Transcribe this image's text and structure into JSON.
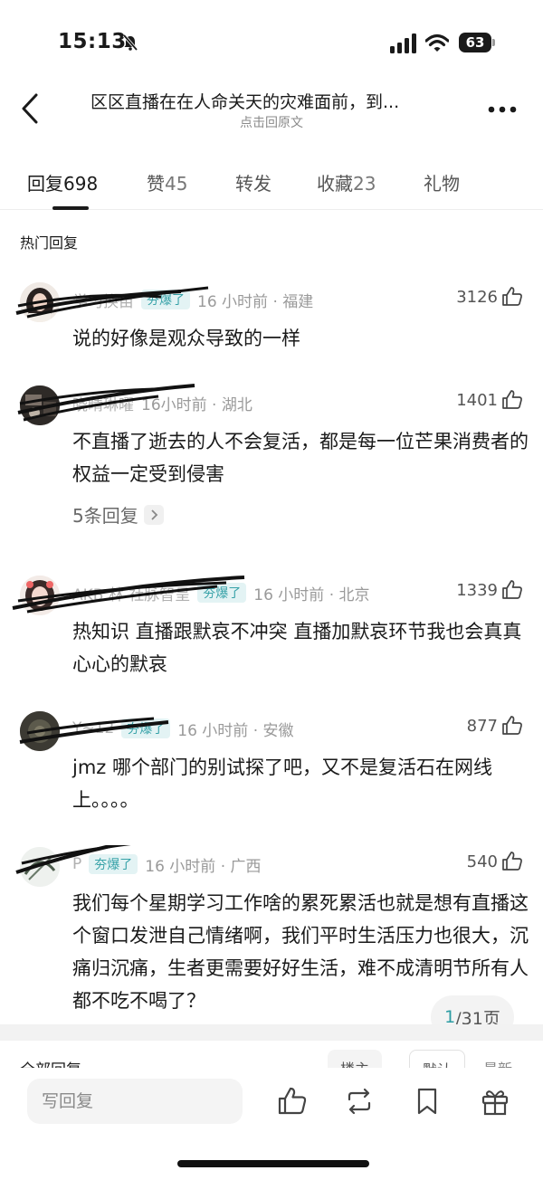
{
  "status_bar": {
    "time": "15:13",
    "battery": "63"
  },
  "header": {
    "title": "区区直播在在人命关天的灾难面前，到...",
    "subtitle": "点击回原文"
  },
  "tabs": [
    {
      "label": "回复",
      "count": "698"
    },
    {
      "label": "赞",
      "count": "45"
    },
    {
      "label": "转发",
      "count": ""
    },
    {
      "label": "收藏",
      "count": "23"
    },
    {
      "label": "礼物",
      "count": ""
    }
  ],
  "hot_section_title": "热门回复",
  "comments": [
    {
      "username": "学习换亩",
      "badge": "夯爆了",
      "time_location": "16 小时前 · 福建",
      "likes": "3126",
      "text": "说的好像是观众导致的一样"
    },
    {
      "username": "晓晴琳曜",
      "badge": "",
      "time_location": "16小时前 · 湖北",
      "likes": "1401",
      "text": "不直播了逝去的人不会复活，都是每一位芒果消费者的权益一定受到侵害",
      "replies": "5条回复"
    },
    {
      "username": "AKB 林 社脉智呈",
      "badge": "夯爆了",
      "time_location": "16 小时前 · 北京",
      "likes": "1339",
      "text": "热知识 直播跟默哀不冲突 直播加默哀环节我也会真真心心的默哀"
    },
    {
      "username": "Y~12",
      "badge": "夯爆了",
      "time_location": "16 小时前 · 安徽",
      "likes": "877",
      "text": "jmz 哪个部门的别试探了吧，又不是复活石在网线上。。。。"
    },
    {
      "username": "P",
      "badge": "夯爆了",
      "time_location": "16 小时前 · 广西",
      "likes": "540",
      "text": "我们每个星期学习工作啥的累死累活也就是想有直播这个窗口发泄自己情绪啊，我们平时生活压力也很大，沉痛归沉痛，生者更需要好好生活，难不成清明节所有人都不吃不喝了？"
    }
  ],
  "pagination": {
    "current": "1",
    "total": "/31页"
  },
  "all_replies": {
    "label": "全部回复",
    "sort_options": [
      "楼主",
      "默认",
      "最新"
    ]
  },
  "bottom_bar": {
    "reply_placeholder": "写回复"
  },
  "colors": {
    "accent": "#37a2a8",
    "badge_bg": "#e3f3f4",
    "text": "#1a1a1a",
    "muted": "#9a9a9a"
  }
}
